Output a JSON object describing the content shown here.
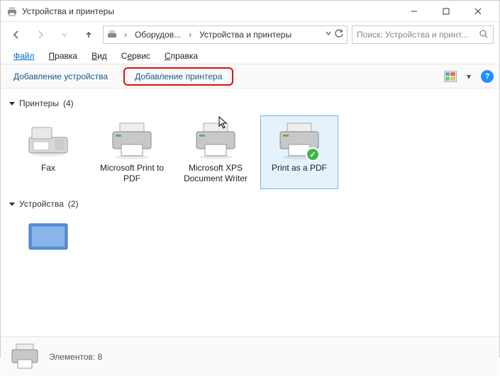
{
  "window": {
    "title": "Устройства и принтеры"
  },
  "nav": {
    "breadcrumb1": "Оборудов...",
    "breadcrumb2": "Устройства и принтеры"
  },
  "search": {
    "placeholder": "Поиск: Устройства и принт..."
  },
  "menu": {
    "file": "Файл",
    "edit": "Правка",
    "view": "Вид",
    "tools": "Сервис",
    "help": "Справка"
  },
  "toolbar": {
    "add_device": "Добавление устройства",
    "add_printer": "Добавление принтера"
  },
  "groups": {
    "printers": {
      "label": "Принтеры",
      "count": "(4)"
    },
    "devices": {
      "label": "Устройства",
      "count": "(2)"
    }
  },
  "printers": [
    {
      "label": "Fax"
    },
    {
      "label": "Microsoft Print to PDF"
    },
    {
      "label": "Microsoft XPS Document Writer"
    },
    {
      "label": "Print as a PDF"
    }
  ],
  "status": {
    "label": "Элементов:",
    "count": "8"
  }
}
